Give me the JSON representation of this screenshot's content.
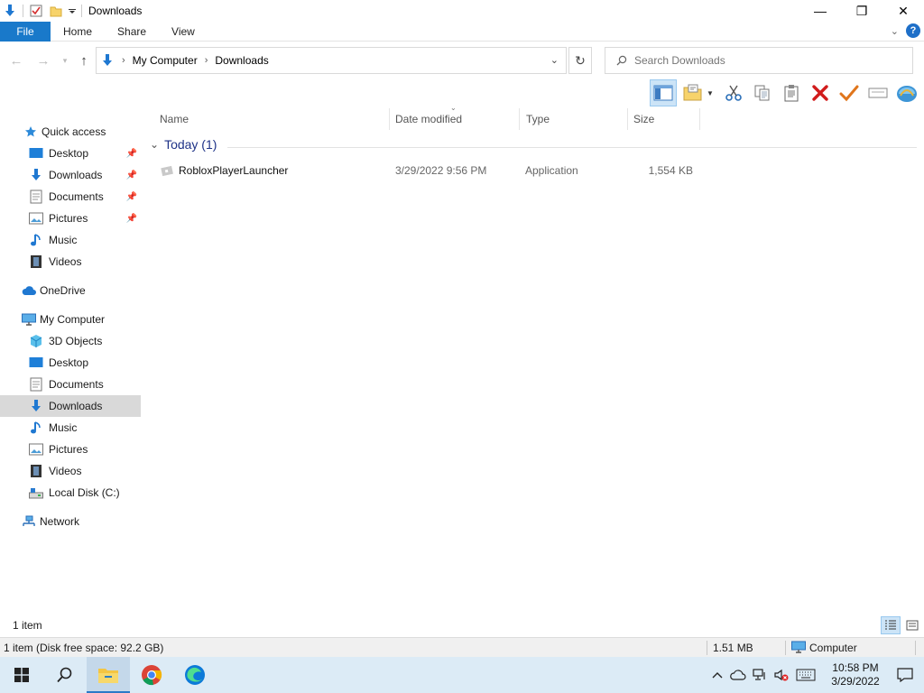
{
  "window": {
    "title": "Downloads",
    "controls": {
      "minimize": "—",
      "restore": "❐",
      "close": "✕"
    }
  },
  "ribbon": {
    "tabs": [
      "File",
      "Home",
      "Share",
      "View"
    ]
  },
  "address": {
    "crumbs": [
      "My Computer",
      "Downloads"
    ],
    "refresh_glyph": "↻"
  },
  "search": {
    "placeholder": "Search Downloads"
  },
  "navpane": {
    "quick_access": "Quick access",
    "quick_items": [
      {
        "label": "Desktop",
        "icon": "desktop-icon",
        "pinned": true
      },
      {
        "label": "Downloads",
        "icon": "downloads-icon",
        "pinned": true
      },
      {
        "label": "Documents",
        "icon": "documents-icon",
        "pinned": true
      },
      {
        "label": "Pictures",
        "icon": "pictures-icon",
        "pinned": true
      },
      {
        "label": "Music",
        "icon": "music-icon",
        "pinned": false
      },
      {
        "label": "Videos",
        "icon": "videos-icon",
        "pinned": false
      }
    ],
    "onedrive": "OneDrive",
    "computer": "My Computer",
    "computer_items": [
      {
        "label": "3D Objects",
        "icon": "3d-objects-icon"
      },
      {
        "label": "Desktop",
        "icon": "desktop-icon"
      },
      {
        "label": "Documents",
        "icon": "documents-icon"
      },
      {
        "label": "Downloads",
        "icon": "downloads-icon",
        "selected": true
      },
      {
        "label": "Music",
        "icon": "music-icon"
      },
      {
        "label": "Pictures",
        "icon": "pictures-icon"
      },
      {
        "label": "Videos",
        "icon": "videos-icon"
      },
      {
        "label": "Local Disk (C:)",
        "icon": "local-disk-icon"
      }
    ],
    "network": "Network"
  },
  "filelist": {
    "columns": {
      "name": "Name",
      "date": "Date modified",
      "type": "Type",
      "size": "Size"
    },
    "group": {
      "label": "Today (1)"
    },
    "files": [
      {
        "name": "RobloxPlayerLauncher",
        "date": "3/29/2022 9:56 PM",
        "type": "Application",
        "size": "1,554 KB"
      }
    ]
  },
  "status": {
    "items": "1 item",
    "detail": "1 item (Disk free space: 92.2 GB)",
    "size": "1.51 MB",
    "location": "Computer"
  },
  "taskbar": {
    "time": "10:58 PM",
    "date": "3/29/2022"
  },
  "colors": {
    "accent": "#1979ca",
    "selection": "#d9d9d9",
    "group_header": "#1e3287",
    "taskbar": "#dcebf6"
  }
}
